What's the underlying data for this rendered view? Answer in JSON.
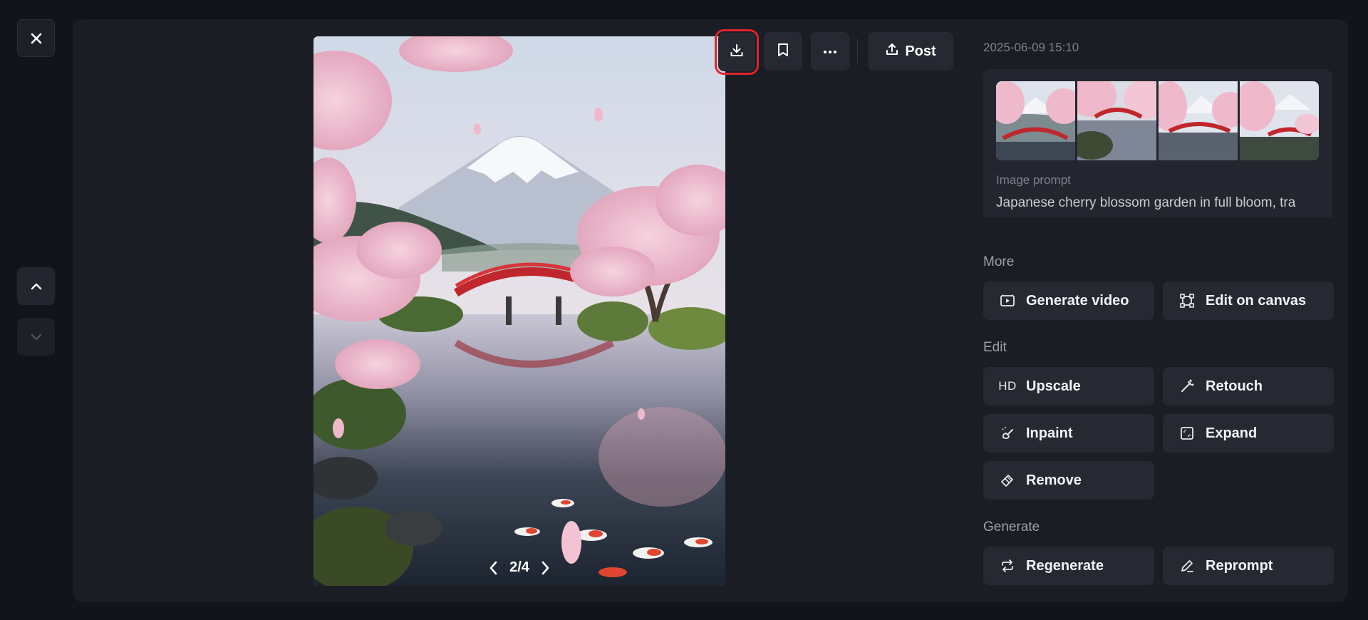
{
  "viewer": {
    "counter": "2/4"
  },
  "toolbar": {
    "download_icon": "download-icon",
    "bookmark_icon": "bookmark-icon",
    "more_icon": "more-horizontal-icon",
    "post_label": "Post"
  },
  "details": {
    "timestamp": "2025-06-09 15:10",
    "prompt_label": "Image prompt",
    "prompt_text": "Japanese cherry blossom garden in full bloom, tra"
  },
  "sections": {
    "more": "More",
    "edit": "Edit",
    "generate": "Generate"
  },
  "actions": {
    "generate_video": "Generate video",
    "edit_on_canvas": "Edit on canvas",
    "upscale_prefix": "HD",
    "upscale": "Upscale",
    "retouch": "Retouch",
    "inpaint": "Inpaint",
    "expand": "Expand",
    "remove": "Remove",
    "regenerate": "Regenerate",
    "reprompt": "Reprompt"
  },
  "colors": {
    "background": "#121419",
    "panel": "#1b1d24",
    "button": "#262931",
    "highlight": "#e0242c"
  }
}
